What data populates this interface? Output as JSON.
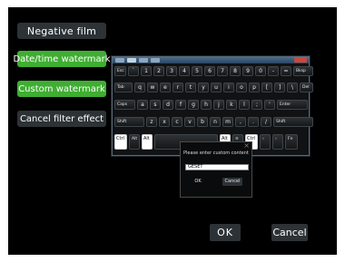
{
  "menu": {
    "negative_film": "Negative film",
    "datetime_watermark": "Date/time watermark",
    "custom_watermark": "Custom watermark",
    "cancel_filter": "Cancel filter effect"
  },
  "dialog": {
    "prompt": "Please enter custom content",
    "input_value": "GESET",
    "ok": "OK",
    "cancel": "Cancel"
  },
  "buttons": {
    "ok": "OK",
    "cancel": "Cancel"
  },
  "keyboard": {
    "row1": [
      {
        "main": "Esc",
        "t": "small"
      },
      {
        "main": "`"
      },
      {
        "main": "1"
      },
      {
        "main": "2"
      },
      {
        "main": "3"
      },
      {
        "main": "4"
      },
      {
        "main": "5"
      },
      {
        "main": "6"
      },
      {
        "main": "7"
      },
      {
        "main": "8"
      },
      {
        "main": "9"
      },
      {
        "main": "0"
      },
      {
        "main": "-"
      },
      {
        "main": "="
      },
      {
        "main": "Bksp",
        "t": "small"
      }
    ],
    "row2": [
      {
        "main": "Tab",
        "t": "small"
      },
      {
        "main": "q"
      },
      {
        "main": "w"
      },
      {
        "main": "e"
      },
      {
        "main": "r"
      },
      {
        "main": "t"
      },
      {
        "main": "y"
      },
      {
        "main": "u"
      },
      {
        "main": "i"
      },
      {
        "main": "o"
      },
      {
        "main": "p"
      },
      {
        "main": "["
      },
      {
        "main": "]"
      },
      {
        "main": "\\"
      },
      {
        "main": "Del",
        "t": "small"
      }
    ],
    "row3": [
      {
        "main": "Caps",
        "t": "small"
      },
      {
        "main": "a"
      },
      {
        "main": "s"
      },
      {
        "main": "d"
      },
      {
        "main": "f"
      },
      {
        "main": "g"
      },
      {
        "main": "h"
      },
      {
        "main": "j"
      },
      {
        "main": "k"
      },
      {
        "main": "l"
      },
      {
        "main": ";"
      },
      {
        "main": "'"
      },
      {
        "main": "Enter",
        "t": "small"
      }
    ],
    "row4": [
      {
        "main": "Shift",
        "t": "small"
      },
      {
        "main": "z"
      },
      {
        "main": "x"
      },
      {
        "main": "c"
      },
      {
        "main": "v"
      },
      {
        "main": "b"
      },
      {
        "main": "n"
      },
      {
        "main": "m"
      },
      {
        "main": ","
      },
      {
        "main": "."
      },
      {
        "main": "/"
      },
      {
        "main": "Shift",
        "t": "small"
      }
    ],
    "row5": [
      {
        "main": "Ctrl",
        "t": "white"
      },
      {
        "main": "Alt",
        "t": "small"
      },
      {
        "main": "Alt",
        "t": "white"
      },
      {
        "main": "",
        "t": "space"
      },
      {
        "main": "Alt",
        "t": "white"
      },
      {
        "main": "≡",
        "t": "small"
      },
      {
        "main": "Ctrl",
        "t": "white"
      },
      {
        "main": "‹",
        "t": "small"
      },
      {
        "main": "›",
        "t": "small"
      },
      {
        "main": "Fn",
        "t": "small"
      }
    ]
  }
}
